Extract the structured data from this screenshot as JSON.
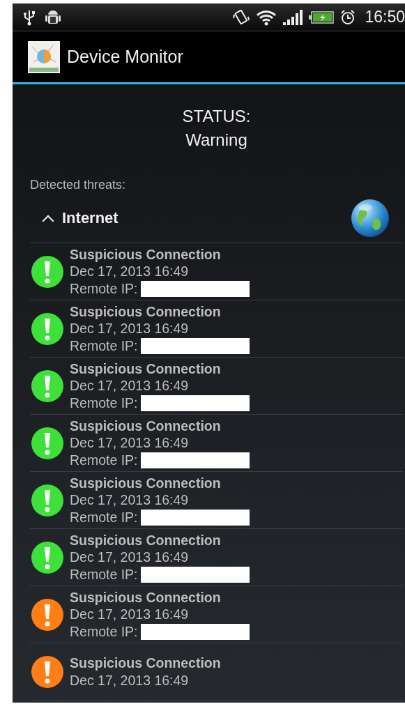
{
  "status_bar": {
    "time": "16:50"
  },
  "action_bar": {
    "title": "Device Monitor"
  },
  "status": {
    "label": "STATUS:",
    "value": "Warning"
  },
  "threats_label": "Detected threats:",
  "section": {
    "title": "Internet",
    "expanded": true,
    "items": [
      {
        "title": "Suspicious Connection",
        "date": "Dec 17, 2013 16:49",
        "ip_label": "Remote IP:",
        "color": "#3ee03a"
      },
      {
        "title": "Suspicious Connection",
        "date": "Dec 17, 2013 16:49",
        "ip_label": "Remote IP:",
        "color": "#3ee03a"
      },
      {
        "title": "Suspicious Connection",
        "date": "Dec 17, 2013 16:49",
        "ip_label": "Remote IP:",
        "color": "#3ee03a"
      },
      {
        "title": "Suspicious Connection",
        "date": "Dec 17, 2013 16:49",
        "ip_label": "Remote IP:",
        "color": "#3ee03a"
      },
      {
        "title": "Suspicious Connection",
        "date": "Dec 17, 2013 16:49",
        "ip_label": "Remote IP:",
        "color": "#3ee03a"
      },
      {
        "title": "Suspicious Connection",
        "date": "Dec 17, 2013 16:49",
        "ip_label": "Remote IP:",
        "color": "#3ee03a"
      },
      {
        "title": "Suspicious Connection",
        "date": "Dec 17, 2013 16:49",
        "ip_label": "Remote IP:",
        "color": "#ff7f16"
      },
      {
        "title": "Suspicious Connection",
        "date": "Dec 17, 2013 16:49",
        "color": "#ff7f16"
      }
    ]
  }
}
